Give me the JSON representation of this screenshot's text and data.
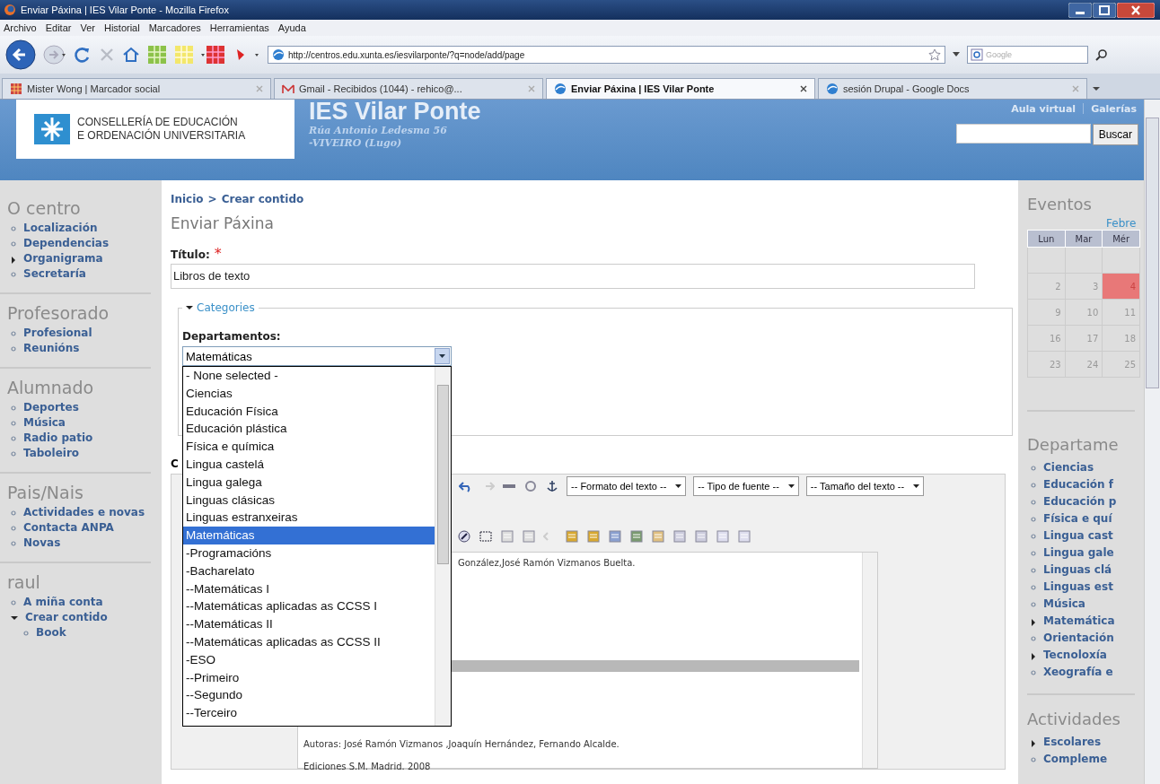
{
  "window": {
    "title": "Enviar Páxina | IES Vilar Ponte - Mozilla Firefox"
  },
  "menu": [
    "Archivo",
    "Editar",
    "Ver",
    "Historial",
    "Marcadores",
    "Herramientas",
    "Ayuda"
  ],
  "address": {
    "value": "http://centros.edu.xunta.es/iesvilarponte/?q=node/add/page"
  },
  "web_search": {
    "placeholder": "Google"
  },
  "tabs": [
    {
      "label": "Mister Wong | Marcador social",
      "selected": false
    },
    {
      "label": "Gmail - Recibidos (1044) - rehico@...",
      "selected": false
    },
    {
      "label": "Enviar Páxina | IES Vilar Ponte",
      "selected": true
    },
    {
      "label": "sesión Drupal - Google Docs",
      "selected": false
    }
  ],
  "site_header": {
    "ministry": [
      "CONSELLERÍA DE EDUCACIÓN",
      "E ORDENACIÓN UNIVERSITARIA"
    ],
    "title": "IES Vilar Ponte",
    "address": [
      "Rúa Antonio Ledesma 56",
      "-VIVEIRO (Lugo)"
    ],
    "links": [
      "Aula virtual",
      "Galerías"
    ],
    "search_button": "Buscar"
  },
  "left_sidebar": [
    {
      "heading": "O centro",
      "items": [
        {
          "label": "Localización",
          "kind": "leaf"
        },
        {
          "label": "Dependencias",
          "kind": "leaf"
        },
        {
          "label": "Organigrama",
          "kind": "collapsed"
        },
        {
          "label": "Secretaría",
          "kind": "leaf"
        }
      ]
    },
    {
      "heading": "Profesorado",
      "items": [
        {
          "label": "Profesional",
          "kind": "leaf"
        },
        {
          "label": "Reunións",
          "kind": "leaf"
        }
      ]
    },
    {
      "heading": "Alumnado",
      "items": [
        {
          "label": "Deportes",
          "kind": "leaf"
        },
        {
          "label": "Música",
          "kind": "leaf"
        },
        {
          "label": "Radio patio",
          "kind": "leaf"
        },
        {
          "label": "Taboleiro",
          "kind": "leaf"
        }
      ]
    },
    {
      "heading": "Pais/Nais",
      "items": [
        {
          "label": "Actividades e novas",
          "kind": "leaf"
        },
        {
          "label": "Contacta ANPA",
          "kind": "leaf"
        },
        {
          "label": "Novas",
          "kind": "leaf"
        }
      ]
    },
    {
      "heading": "raul",
      "items": [
        {
          "label": "A miña conta",
          "kind": "leaf"
        },
        {
          "label": "Crear contido",
          "kind": "expanded",
          "children": [
            {
              "label": "Book",
              "kind": "leaf"
            }
          ]
        }
      ]
    }
  ],
  "breadcrumb": {
    "items": [
      "Inicio",
      "Crear contido"
    ],
    "separator": ">"
  },
  "page_title": "Enviar Páxina",
  "form": {
    "title_label": "Título:",
    "required_mark": "*",
    "title_value": "Libros de texto",
    "fieldset": {
      "legend": "Categories",
      "expanded": true
    },
    "departments_label": "Departamentos:",
    "departments_value": "Matemáticas",
    "dropdown_open": true,
    "options": [
      {
        "label": "- None selected -",
        "selected": false
      },
      {
        "label": "Ciencias",
        "selected": false
      },
      {
        "label": "Educación Física",
        "selected": false
      },
      {
        "label": "Educación plástica",
        "selected": false
      },
      {
        "label": "Física e química",
        "selected": false
      },
      {
        "label": "Lingua castelá",
        "selected": false
      },
      {
        "label": "Lingua galega",
        "selected": false
      },
      {
        "label": "Linguas clásicas",
        "selected": false
      },
      {
        "label": "Linguas estranxeiras",
        "selected": false
      },
      {
        "label": "Matemáticas",
        "selected": true
      },
      {
        "label": "-Programacións",
        "selected": false
      },
      {
        "label": "-Bacharelato",
        "selected": false
      },
      {
        "label": "--Matemáticas I",
        "selected": false
      },
      {
        "label": "--Matemáticas aplicadas as CCSS I",
        "selected": false
      },
      {
        "label": "--Matemáticas II",
        "selected": false
      },
      {
        "label": "--Matemáticas aplicadas as CCSS II",
        "selected": false
      },
      {
        "label": "-ESO",
        "selected": false
      },
      {
        "label": "--Primeiro",
        "selected": false
      },
      {
        "label": "--Segundo",
        "selected": false
      },
      {
        "label": "--Terceiro",
        "selected": false
      }
    ],
    "body_label": "C"
  },
  "editor": {
    "format_selects": [
      "-- Formato del texto --",
      "-- Tipo de fuente --",
      "-- Tamaño del texto --"
    ],
    "lines": [
      "González,José Ramón Vizmanos Buelta.",
      "Autoras: José Ramón Vizmanos ,Joaquín Hernández, Fernando Alcalde.",
      "Ediciones S.M. Madrid. 2008"
    ]
  },
  "right_sidebar": {
    "events_heading": "Eventos",
    "month": "Febre",
    "weekdays": [
      "Lun",
      "Mar",
      "Mér"
    ],
    "leading_blank_week": true,
    "weeks": [
      [
        {
          "day": "2",
          "today": false
        },
        {
          "day": "3",
          "today": false
        },
        {
          "day": "4",
          "today": true
        }
      ],
      [
        {
          "day": "9",
          "today": false
        },
        {
          "day": "10",
          "today": false
        },
        {
          "day": "11",
          "today": false
        }
      ],
      [
        {
          "day": "16",
          "today": false
        },
        {
          "day": "17",
          "today": false
        },
        {
          "day": "18",
          "today": false
        }
      ],
      [
        {
          "day": "23",
          "today": false
        },
        {
          "day": "24",
          "today": false
        },
        {
          "day": "25",
          "today": false
        }
      ]
    ],
    "departments_heading": "Departame",
    "departments": [
      {
        "label": "Ciencias",
        "kind": "leaf"
      },
      {
        "label": "Educación f",
        "kind": "leaf"
      },
      {
        "label": "Educación p",
        "kind": "leaf"
      },
      {
        "label": "Física e quí",
        "kind": "leaf"
      },
      {
        "label": "Lingua cast",
        "kind": "leaf"
      },
      {
        "label": "Lingua gale",
        "kind": "leaf"
      },
      {
        "label": "Linguas clá",
        "kind": "leaf"
      },
      {
        "label": "Linguas est",
        "kind": "leaf"
      },
      {
        "label": "Música",
        "kind": "leaf"
      },
      {
        "label": "Matemática",
        "kind": "collapsed"
      },
      {
        "label": "Orientación",
        "kind": "leaf"
      },
      {
        "label": "Tecnoloxía",
        "kind": "collapsed"
      },
      {
        "label": "Xeografía e",
        "kind": "leaf"
      }
    ],
    "activities_heading": "Actividades",
    "activities": [
      {
        "label": "Escolares",
        "kind": "collapsed"
      },
      {
        "label": "Compleme",
        "kind": "leaf"
      }
    ]
  }
}
